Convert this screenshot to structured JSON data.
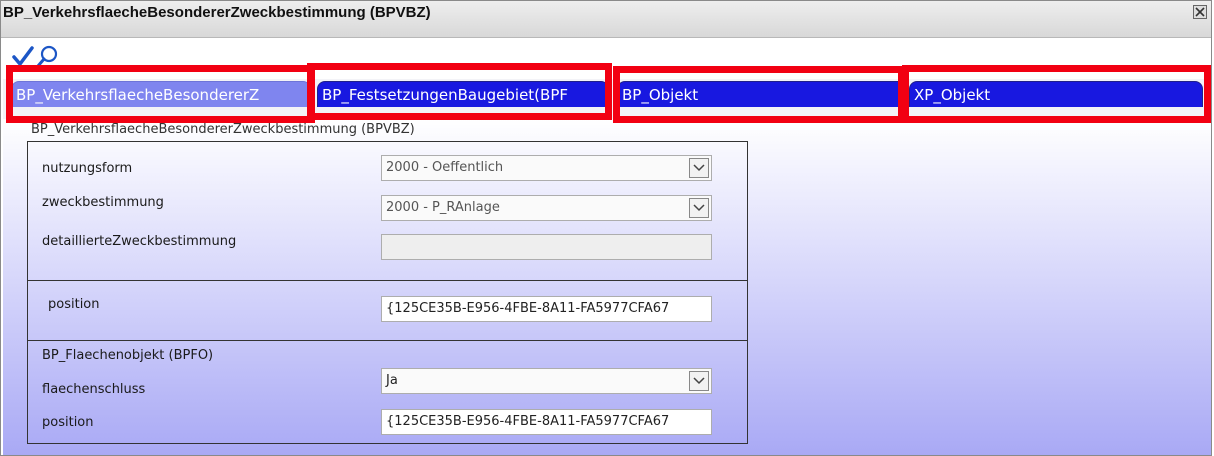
{
  "window": {
    "title": "BP_VerkehrsflaecheBesondererZweckbestimmung (BPVBZ)"
  },
  "toolbar": {
    "icons": [
      "checkmark-icon",
      "zoom-search-icon"
    ]
  },
  "tabs": [
    {
      "label": "BP_VerkehrsflaecheBesondererZ",
      "active": true
    },
    {
      "label": "BP_FestsetzungenBaugebiet(BPF",
      "active": false
    },
    {
      "label": "BP_Objekt",
      "active": false
    },
    {
      "label": "XP_Objekt",
      "active": false
    }
  ],
  "colors": {
    "highlight": "#f20012",
    "tab_inactive": "#1818e0",
    "tab_active": "#7f85ef",
    "gradient_bottom": "#a9a9f5"
  },
  "section": {
    "label": "BP_VerkehrsflaecheBesondererZweckbestimmung (BPVBZ)",
    "fields": {
      "nutzungsform": {
        "label": "nutzungsform",
        "value": "2000 - Oeffentlich"
      },
      "zweckbestimmung": {
        "label": "zweckbestimmung",
        "value": "2000 - P_RAnlage"
      },
      "detaillierte": {
        "label": "detaillierteZweckbestimmung",
        "value": ""
      }
    },
    "position": {
      "label": "position",
      "value": "{125CE35B-E956-4FBE-8A11-FA5977CFA67"
    }
  },
  "flaechenobjekt": {
    "header": "BP_Flaechenobjekt (BPFO)",
    "flaechenschluss": {
      "label": "flaechenschluss",
      "value": "Ja"
    },
    "position": {
      "label": "position",
      "value": "{125CE35B-E956-4FBE-8A11-FA5977CFA67"
    }
  }
}
